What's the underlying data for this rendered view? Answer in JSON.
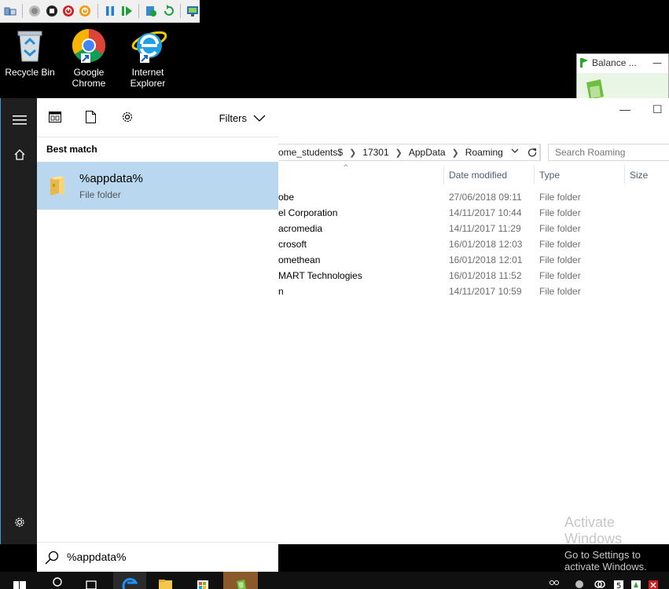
{
  "desktop": {
    "icons": [
      {
        "label": "Recycle Bin",
        "icon": "recycle-bin-icon"
      },
      {
        "label": "Google Chrome",
        "icon": "chrome-icon"
      },
      {
        "label": "Internet Explorer",
        "icon": "internet-explorer-icon"
      }
    ]
  },
  "balance_window": {
    "title": "Balance ..."
  },
  "explorer": {
    "breadcrumb": [
      "ome_students$",
      "17301",
      "AppData",
      "Roaming"
    ],
    "search_placeholder": "Search Roaming",
    "columns": {
      "date": "Date modified",
      "type": "Type",
      "size": "Size"
    },
    "rows": [
      {
        "name": "obe",
        "date": "27/06/2018 09:11",
        "type": "File folder"
      },
      {
        "name": "el Corporation",
        "date": "14/11/2017 10:44",
        "type": "File folder"
      },
      {
        "name": "acromedia",
        "date": "14/11/2017 11:29",
        "type": "File folder"
      },
      {
        "name": "crosoft",
        "date": "16/01/2018 12:03",
        "type": "File folder"
      },
      {
        "name": "omethean",
        "date": "16/01/2018 12:01",
        "type": "File folder"
      },
      {
        "name": "MART Technologies",
        "date": "16/01/2018 11:52",
        "type": "File folder"
      },
      {
        "name": "n",
        "date": "14/11/2017 10:59",
        "type": "File folder"
      }
    ],
    "minimize": "—",
    "maximize": "☐"
  },
  "watermark": {
    "line1": "Activate Windows",
    "line2": "Go to Settings to activate Windows."
  },
  "start": {
    "filters_label": "Filters",
    "section_title": "Best match",
    "result_title": "%appdata%",
    "result_subtitle": "File folder",
    "search_text": "%appdata%"
  },
  "colors": {
    "accent": "#0078d7",
    "selection": "#b9d7ef",
    "rail": "#1f1f1f"
  }
}
